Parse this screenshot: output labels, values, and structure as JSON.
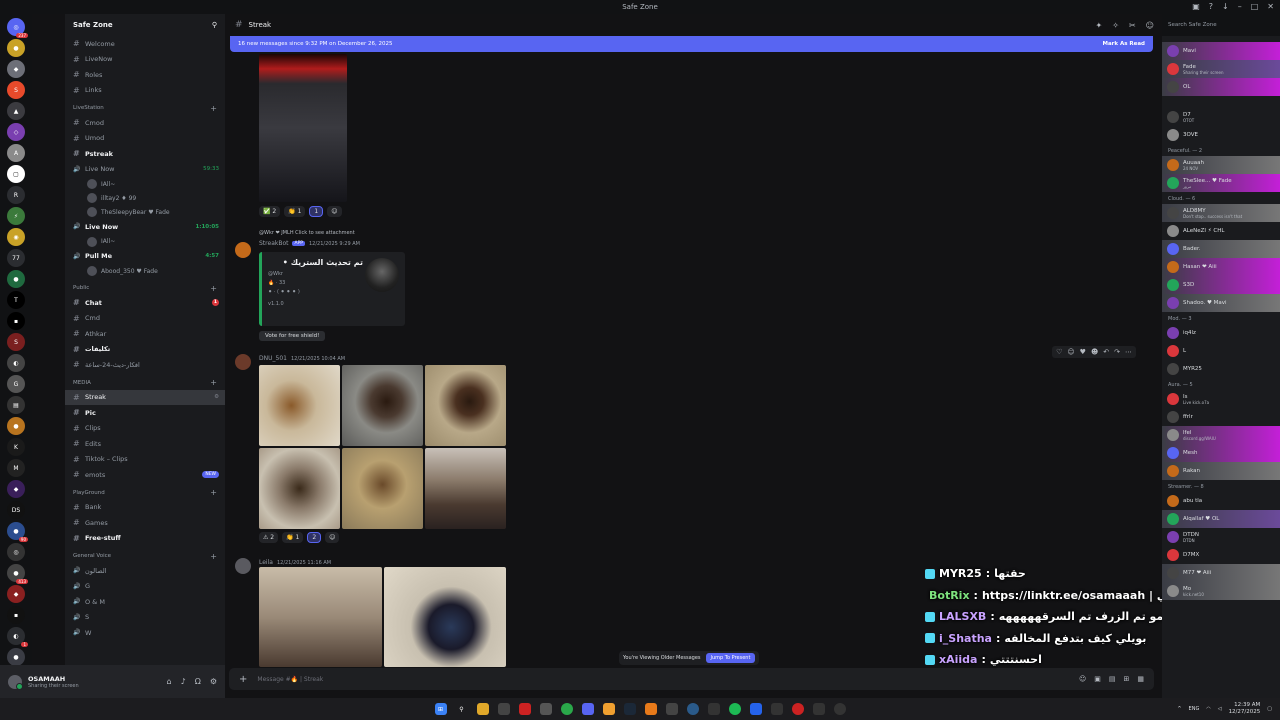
{
  "window": {
    "title": "Safe Zone"
  },
  "server": {
    "name": "Safe Zone"
  },
  "channels": {
    "top": [
      "Welcome",
      "LiveNow",
      "Roles",
      "Links"
    ],
    "cat_livestation": "LiveStation",
    "livestation": [
      {
        "name": "Cmod"
      },
      {
        "name": "Umod"
      },
      {
        "name": "Pstreak",
        "bold": true
      },
      {
        "name": "Live Now",
        "time": "59:33"
      }
    ],
    "live1_users": [
      "IAll~",
      "illtay2 ♦ 99",
      "TheSleepyBear ♥ Fade"
    ],
    "live2": {
      "name": "Live Now",
      "time": "1:10:05"
    },
    "pullme": {
      "name": "Pull Me",
      "time": "4:57"
    },
    "pullme_user": "Abood_350 ♥ Fade",
    "cat_public": "Public",
    "public": [
      {
        "name": "Chat",
        "badge": "1",
        "bold": true
      },
      {
        "name": "Cmd"
      },
      {
        "name": "Athkar"
      },
      {
        "name": "تكليفات",
        "bold": true
      },
      {
        "name": "افكار-ديث-24-ساعة"
      }
    ],
    "cat_media": "MEDIA",
    "media": [
      {
        "name": "Streak",
        "active": true
      },
      {
        "name": "Pic",
        "bold": true
      },
      {
        "name": "Clips"
      },
      {
        "name": "Edits"
      },
      {
        "name": "Tiktok – Clips"
      },
      {
        "name": "emots",
        "new": "NEW"
      }
    ],
    "cat_playground": "PlayGround",
    "playground": [
      {
        "name": "Bank"
      },
      {
        "name": "Games"
      },
      {
        "name": "Free-stuff",
        "bold": true
      }
    ],
    "cat_voice": "General Voice",
    "voice": [
      "الصالون",
      "G",
      "O & M",
      "S",
      "W"
    ]
  },
  "user": {
    "name": "OSAMAAH",
    "status": "Sharing their screen"
  },
  "header": {
    "channel": "Streak"
  },
  "newbar": {
    "text": "16 new messages since 9:32 PM on December 26, 2025",
    "action": "Mark As Read"
  },
  "msg1": {
    "reactions": [
      "✅ 2",
      "👏 1",
      "1"
    ]
  },
  "msg2": {
    "reply": "@Wkr ❤ JMLH  Click to see attachment",
    "author": "StreakBot",
    "tag": "APP",
    "time": "12/21/2025 9:29 AM",
    "embed_title": "تم تحديث الستريك •",
    "embed_user": "@Wkr",
    "embed_line1": "🔥 · 33",
    "embed_line2": "⚫ · ( ⚫ ⚫ ⚫ )",
    "embed_version": "v1.1.0",
    "vote": "Vote for free shield!"
  },
  "msg3": {
    "author": "DNU_501",
    "time": "12/21/2025 10:04 AM",
    "reactions": [
      "⚠ 2",
      "👏 1",
      "2"
    ]
  },
  "msg4": {
    "author": "Leila",
    "time": "12/21/2025 11:16 AM"
  },
  "older": {
    "text": "You're Viewing Older Messages",
    "button": "Jump To Present"
  },
  "composer": {
    "placeholder": "Message #🔥 | Streak"
  },
  "overlay": [
    {
      "user": "MYR25",
      "msg": "حقتها"
    },
    {
      "user": "BotRix",
      "msg": "https://linktr.ee/osamaaah | هنا تلقون كل حساباتي"
    },
    {
      "user": "LALSXB",
      "msg": "هاذي مو تم الزرف تم السرقهههههه"
    },
    {
      "user": "i_Shatha",
      "msg": "بويلي كيف بتدفع المخالفه"
    },
    {
      "user": "xAiida",
      "msg": "احسنتتتي"
    }
  ],
  "members": {
    "search": "Search Safe Zone",
    "top": [
      {
        "n": "Mavi",
        "s": ""
      },
      {
        "n": "Fade",
        "s": "Sharing their screen"
      },
      {
        "n": "OL",
        "s": ""
      }
    ],
    "g_unk": [
      {
        "n": "D7",
        "s": "OTOT"
      },
      {
        "n": "3OVE",
        "s": ""
      }
    ],
    "g_peaceful": "Peaceful. — 2",
    "peaceful": [
      {
        "n": "Auuaah",
        "s": "24 NOV"
      },
      {
        "n": "TheSlee... ♥ Fade",
        "s": "مرور"
      }
    ],
    "g_cloud": "Cloud. — 6",
    "cloud": [
      {
        "n": "ALD8MY",
        "s": "Don't stop.. success isn't that"
      },
      {
        "n": "ALeNeZI ⚡ CHL",
        "s": ""
      },
      {
        "n": "Bader.",
        "s": ""
      },
      {
        "n": "Hasan ❤ Aiii",
        "s": ""
      },
      {
        "n": "S3D",
        "s": ""
      },
      {
        "n": "Shadoo. ♥ Mavi",
        "s": ""
      }
    ],
    "g_mod": "Mod. — 3",
    "mod": [
      {
        "n": "iq4lz",
        "s": ""
      },
      {
        "n": "L",
        "s": ""
      },
      {
        "n": "MYR25",
        "s": ""
      }
    ],
    "g_aura": "Aura. — 5",
    "aura": [
      {
        "n": "Is",
        "s": "Live kick.o7a"
      },
      {
        "n": "ffrlr",
        "s": ""
      },
      {
        "n": "lfel",
        "s": "discord.gg/WAIU"
      },
      {
        "n": "Mesh",
        "s": ""
      },
      {
        "n": "Rakan",
        "s": ""
      }
    ],
    "g_streamer": "Streamer. — 8",
    "streamer": [
      {
        "n": "abu tla",
        "s": ""
      },
      {
        "n": "Alqallaf ♥ OL",
        "s": ""
      },
      {
        "n": "DTDN",
        "s": "DTDN"
      },
      {
        "n": "D7MX",
        "s": ""
      },
      {
        "n": "M77 ❤ Aiii",
        "s": ""
      },
      {
        "n": "Mo",
        "s": "kick.net10"
      }
    ]
  },
  "tray": {
    "lang": "ENG",
    "time": "12:39 AM",
    "date": "12/27/2025"
  },
  "colors": {
    "accent": "#5865f2",
    "bg": "#121214",
    "sidebar": "#1a1b1e",
    "online": "#23a55a",
    "danger": "#da373c"
  }
}
